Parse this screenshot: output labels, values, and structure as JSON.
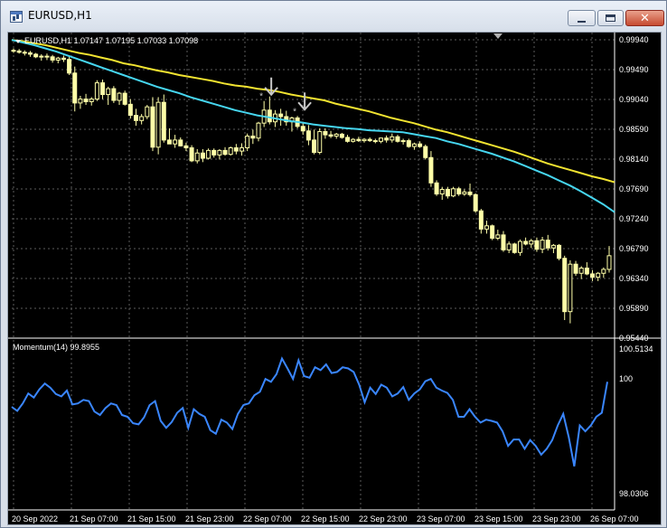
{
  "window": {
    "title": "EURUSD,H1"
  },
  "chart": {
    "info_label": "EURUSD,H1  1.07147 1.07195 1.07033 1.07098",
    "price_ticks": [
      "0.99940",
      "0.99490",
      "0.99040",
      "0.98590",
      "0.98140",
      "0.97690",
      "0.97240",
      "0.96790",
      "0.96340",
      "0.95890",
      "0.95440"
    ],
    "time_ticks": [
      "20 Sep 2022",
      "21 Sep 07:00",
      "21 Sep 15:00",
      "21 Sep 23:00",
      "22 Sep 07:00",
      "22 Sep 15:00",
      "22 Sep 23:00",
      "23 Sep 07:00",
      "23 Sep 15:00",
      "23 Sep 23:00",
      "26 Sep 07:00"
    ],
    "indicator_label": "Momentum(14) 99.8955",
    "indicator_ticks": [
      "100.5134",
      "100",
      "98.0306"
    ],
    "colors": {
      "background": "#000000",
      "grid": "#5c5c5c",
      "candle": "#ffffa8",
      "ma_slow": "#f2e431",
      "ma_fast": "#46d6f0",
      "momentum": "#3a86ff",
      "text": "#ffffff",
      "arrow": "#c8c8c8"
    },
    "icons": [
      "window-app-icon",
      "minimize-icon",
      "maximize-icon",
      "close-icon",
      "sell-arrow-icon",
      "scroll-marker-icon"
    ]
  },
  "chart_data": [
    {
      "type": "candlestick",
      "title": "EURUSD,H1",
      "ylim": [
        0.954,
        0.9999
      ],
      "ohlc": [
        [
          0.998,
          0.9983,
          0.9976,
          0.9979
        ],
        [
          0.9979,
          0.9982,
          0.9975,
          0.9977
        ],
        [
          0.9977,
          0.998,
          0.9972,
          0.9976
        ],
        [
          0.9976,
          0.9979,
          0.997,
          0.9974
        ],
        [
          0.9974,
          0.9976,
          0.9968,
          0.997
        ],
        [
          0.997,
          0.9974,
          0.9964,
          0.9971
        ],
        [
          0.9971,
          0.9975,
          0.9965,
          0.997
        ],
        [
          0.997,
          0.9973,
          0.9961,
          0.9965
        ],
        [
          0.9965,
          0.997,
          0.996,
          0.9968
        ],
        [
          0.9968,
          0.9972,
          0.9962,
          0.9966
        ],
        [
          0.9966,
          0.997,
          0.9942,
          0.9945
        ],
        [
          0.9945,
          0.9955,
          0.9886,
          0.9899
        ],
        [
          0.9899,
          0.991,
          0.989,
          0.9905
        ],
        [
          0.9905,
          0.9913,
          0.9896,
          0.9901
        ],
        [
          0.9901,
          0.9908,
          0.9895,
          0.9905
        ],
        [
          0.9905,
          0.9934,
          0.9902,
          0.993
        ],
        [
          0.993,
          0.9935,
          0.9905,
          0.9912
        ],
        [
          0.9912,
          0.9924,
          0.9896,
          0.9921
        ],
        [
          0.9921,
          0.9925,
          0.9899,
          0.9903
        ],
        [
          0.9903,
          0.9916,
          0.9896,
          0.9914
        ],
        [
          0.9914,
          0.9918,
          0.9895,
          0.9897
        ],
        [
          0.9897,
          0.9905,
          0.9875,
          0.988
        ],
        [
          0.988,
          0.989,
          0.9864,
          0.9872
        ],
        [
          0.9872,
          0.9882,
          0.9866,
          0.9878
        ],
        [
          0.9878,
          0.9896,
          0.9874,
          0.9893
        ],
        [
          0.9893,
          0.9908,
          0.9825,
          0.9831
        ],
        [
          0.9831,
          0.9908,
          0.982,
          0.99
        ],
        [
          0.99,
          0.9912,
          0.9838,
          0.9842
        ],
        [
          0.9842,
          0.986,
          0.9836,
          0.9836
        ],
        [
          0.9836,
          0.985,
          0.983,
          0.9842
        ],
        [
          0.9842,
          0.9846,
          0.9832,
          0.9833
        ],
        [
          0.9833,
          0.9838,
          0.9825,
          0.983
        ],
        [
          0.983,
          0.9834,
          0.9808,
          0.981
        ],
        [
          0.981,
          0.9828,
          0.9806,
          0.9822
        ],
        [
          0.9822,
          0.9828,
          0.9808,
          0.9814
        ],
        [
          0.9814,
          0.9829,
          0.9812,
          0.9826
        ],
        [
          0.9826,
          0.9829,
          0.9815,
          0.9819
        ],
        [
          0.9819,
          0.9828,
          0.9812,
          0.9826
        ],
        [
          0.9826,
          0.9831,
          0.9818,
          0.982
        ],
        [
          0.982,
          0.9832,
          0.9818,
          0.983
        ],
        [
          0.983,
          0.9836,
          0.982,
          0.9825
        ],
        [
          0.9825,
          0.9837,
          0.9818,
          0.983
        ],
        [
          0.983,
          0.9852,
          0.9825,
          0.9848
        ],
        [
          0.9848,
          0.9858,
          0.9836,
          0.9845
        ],
        [
          0.9845,
          0.987,
          0.984,
          0.9868
        ],
        [
          0.9868,
          0.9902,
          0.9862,
          0.9888
        ],
        [
          0.9888,
          0.9909,
          0.9866,
          0.987
        ],
        [
          0.987,
          0.9888,
          0.9862,
          0.9882
        ],
        [
          0.9882,
          0.989,
          0.9864,
          0.9878
        ],
        [
          0.9878,
          0.9887,
          0.9864,
          0.987
        ],
        [
          0.987,
          0.9878,
          0.9855,
          0.9876
        ],
        [
          0.9876,
          0.9879,
          0.986,
          0.9863
        ],
        [
          0.9863,
          0.987,
          0.985,
          0.9856
        ],
        [
          0.9856,
          0.9865,
          0.9834,
          0.9842
        ],
        [
          0.9842,
          0.9858,
          0.982,
          0.9823
        ],
        [
          0.9823,
          0.986,
          0.982,
          0.9855
        ],
        [
          0.9855,
          0.986,
          0.9844,
          0.985
        ],
        [
          0.985,
          0.9856,
          0.9845,
          0.9848
        ],
        [
          0.9848,
          0.9853,
          0.9844,
          0.9851
        ],
        [
          0.9851,
          0.9853,
          0.9844,
          0.9846
        ],
        [
          0.9846,
          0.985,
          0.9838,
          0.984
        ],
        [
          0.984,
          0.9845,
          0.9838,
          0.9843
        ],
        [
          0.9843,
          0.9847,
          0.9839,
          0.9841
        ],
        [
          0.9841,
          0.9845,
          0.9838,
          0.9843
        ],
        [
          0.9843,
          0.9846,
          0.9839,
          0.9841
        ],
        [
          0.9841,
          0.9844,
          0.9837,
          0.984
        ],
        [
          0.984,
          0.9846,
          0.9837,
          0.9845
        ],
        [
          0.9845,
          0.9849,
          0.9838,
          0.9842
        ],
        [
          0.9842,
          0.9852,
          0.9838,
          0.9847
        ],
        [
          0.9847,
          0.985,
          0.9838,
          0.984
        ],
        [
          0.984,
          0.9844,
          0.9835,
          0.9841
        ],
        [
          0.9841,
          0.9844,
          0.983,
          0.9832
        ],
        [
          0.9832,
          0.9838,
          0.9827,
          0.9836
        ],
        [
          0.9836,
          0.984,
          0.983,
          0.9832
        ],
        [
          0.9832,
          0.9835,
          0.9812,
          0.9815
        ],
        [
          0.9815,
          0.9825,
          0.977,
          0.9776
        ],
        [
          0.9776,
          0.978,
          0.9756,
          0.9759
        ],
        [
          0.9759,
          0.977,
          0.975,
          0.9766
        ],
        [
          0.9766,
          0.977,
          0.9752,
          0.9756
        ],
        [
          0.9756,
          0.977,
          0.9754,
          0.9767
        ],
        [
          0.9767,
          0.977,
          0.9756,
          0.9759
        ],
        [
          0.9759,
          0.9766,
          0.9756,
          0.9762
        ],
        [
          0.9762,
          0.9775,
          0.9755,
          0.9758
        ],
        [
          0.9758,
          0.976,
          0.973,
          0.9733
        ],
        [
          0.9733,
          0.9736,
          0.9698,
          0.9705
        ],
        [
          0.9705,
          0.9718,
          0.9698,
          0.971
        ],
        [
          0.971,
          0.9712,
          0.9688,
          0.9691
        ],
        [
          0.9691,
          0.9704,
          0.9688,
          0.9696
        ],
        [
          0.9696,
          0.9702,
          0.967,
          0.9673
        ],
        [
          0.9673,
          0.9686,
          0.9668,
          0.9682
        ],
        [
          0.9682,
          0.9684,
          0.9667,
          0.9669
        ],
        [
          0.9669,
          0.9689,
          0.9664,
          0.9686
        ],
        [
          0.9686,
          0.9692,
          0.968,
          0.9682
        ],
        [
          0.9682,
          0.969,
          0.9676,
          0.9687
        ],
        [
          0.9687,
          0.9692,
          0.967,
          0.9674
        ],
        [
          0.9674,
          0.9693,
          0.9668,
          0.9688
        ],
        [
          0.9688,
          0.9696,
          0.9672,
          0.9676
        ],
        [
          0.9676,
          0.9682,
          0.9668,
          0.968
        ],
        [
          0.968,
          0.9682,
          0.9657,
          0.966
        ],
        [
          0.966,
          0.9664,
          0.9565,
          0.9578
        ],
        [
          0.9578,
          0.9657,
          0.956,
          0.9651
        ],
        [
          0.9651,
          0.9656,
          0.9633,
          0.9637
        ],
        [
          0.9637,
          0.9648,
          0.9628,
          0.9645
        ],
        [
          0.9645,
          0.9654,
          0.9634,
          0.9636
        ],
        [
          0.9636,
          0.9642,
          0.9625,
          0.9631
        ],
        [
          0.9631,
          0.9639,
          0.9625,
          0.9637
        ],
        [
          0.9637,
          0.9646,
          0.963,
          0.9643
        ],
        [
          0.9643,
          0.9679,
          0.9638,
          0.9664
        ]
      ],
      "series": [
        {
          "name": "ma_slow",
          "values": [
            0.9996,
            0.9994,
            0.9991,
            0.9988,
            0.9984,
            0.998,
            0.9976,
            0.9973,
            0.9969,
            0.9965,
            0.996,
            0.9957,
            0.9953,
            0.9949,
            0.9946,
            0.9942,
            0.9939,
            0.9936,
            0.9933,
            0.9929,
            0.9926,
            0.9924,
            0.9921,
            0.9919,
            0.9916,
            0.9912,
            0.9909,
            0.9906,
            0.9903,
            0.9898,
            0.9894,
            0.989,
            0.9886,
            0.9881,
            0.9876,
            0.9872,
            0.9868,
            0.9863,
            0.9858,
            0.9854,
            0.9849,
            0.9844,
            0.9839,
            0.9834,
            0.9829,
            0.9824,
            0.9818,
            0.9812,
            0.9806,
            0.9801,
            0.9796,
            0.9791,
            0.9786,
            0.9782,
            0.9777
          ]
        },
        {
          "name": "ma_fast",
          "values": [
            0.9996,
            0.9992,
            0.9988,
            0.9983,
            0.9978,
            0.9972,
            0.9966,
            0.996,
            0.9954,
            0.9948,
            0.9942,
            0.9936,
            0.993,
            0.9924,
            0.9919,
            0.9914,
            0.9908,
            0.9903,
            0.9898,
            0.9893,
            0.9888,
            0.9884,
            0.988,
            0.9877,
            0.9874,
            0.9871,
            0.9869,
            0.9866,
            0.9864,
            0.9862,
            0.986,
            0.9859,
            0.9857,
            0.9856,
            0.9855,
            0.9854,
            0.9851,
            0.9848,
            0.9845,
            0.984,
            0.9836,
            0.9831,
            0.9826,
            0.9821,
            0.9815,
            0.9809,
            0.9802,
            0.9795,
            0.9788,
            0.978,
            0.9772,
            0.9763,
            0.9753,
            0.9743,
            0.9731
          ]
        }
      ],
      "markers": [
        {
          "type": "sell-arrow",
          "index": 45
        },
        {
          "type": "sell-arrow",
          "index": 51
        }
      ]
    },
    {
      "type": "line",
      "title": "Momentum(14) 99.8955",
      "ylim": [
        98.0306,
        100.5134
      ],
      "series": [
        {
          "name": "Momentum(14)",
          "values": [
            99.52,
            99.45,
            99.58,
            99.75,
            99.68,
            99.82,
            99.92,
            99.85,
            99.74,
            99.7,
            99.8,
            99.56,
            99.58,
            99.64,
            99.62,
            99.44,
            99.38,
            99.5,
            99.58,
            99.55,
            99.38,
            99.35,
            99.24,
            99.22,
            99.34,
            99.55,
            99.62,
            99.28,
            99.16,
            99.26,
            99.42,
            99.5,
            99.16,
            99.48,
            99.4,
            99.35,
            99.12,
            99.06,
            99.3,
            99.25,
            99.14,
            99.4,
            99.55,
            99.58,
            99.72,
            99.78,
            100.0,
            99.95,
            100.08,
            100.35,
            100.18,
            100.0,
            100.32,
            100.05,
            100.02,
            100.2,
            100.15,
            100.25,
            100.1,
            100.12,
            100.2,
            100.18,
            100.12,
            99.9,
            99.6,
            99.85,
            99.74,
            99.9,
            99.85,
            99.7,
            99.75,
            99.86,
            99.64,
            99.75,
            99.82,
            99.96,
            100.0,
            99.85,
            99.8,
            99.76,
            99.64,
            99.35,
            99.35,
            99.48,
            99.35,
            99.25,
            99.3,
            99.28,
            99.25,
            99.1,
            98.85,
            98.96,
            98.96,
            98.8,
            98.95,
            98.85,
            98.7,
            98.8,
            98.95,
            99.2,
            99.4,
            99.0,
            98.5,
            99.2,
            99.1,
            99.2,
            99.35,
            99.42,
            99.95
          ]
        }
      ]
    }
  ]
}
